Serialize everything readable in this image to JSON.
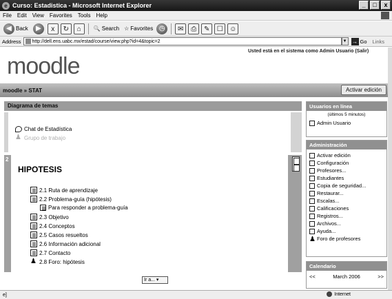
{
  "window": {
    "title": "Curso: Estadistica - Microsoft Internet Explorer",
    "buttons": [
      "_",
      "□",
      "x"
    ]
  },
  "menu": [
    "File",
    "Edit",
    "View",
    "Favorites",
    "Tools",
    "Help"
  ],
  "toolbar": {
    "back": "Back",
    "search": "Search",
    "favorites": "Favorites"
  },
  "address": {
    "label": "Address",
    "url": "http://dell.ens.uabc.mx/estad/course/view.php?id=4&topic=2",
    "go": "Go",
    "links": "Links"
  },
  "page": {
    "login_info": "Usted está en el sistema como Admin Usuario (Salir)",
    "logo": "moodle",
    "breadcrumb": "moodle » STAT",
    "edit_button": "Activar edición",
    "topics_header": "Diagrama de temas",
    "section0": {
      "items": [
        "Chat de Estadística",
        "Grupo de trabajo"
      ]
    },
    "section1": {
      "number": "2",
      "title": "HIPOTESIS",
      "items": [
        {
          "label": "2.1 Ruta de aprendizaje",
          "icon": "doc-icon"
        },
        {
          "label": "2.2 Problema-guía (hipótesis)",
          "icon": "doc-icon"
        },
        {
          "label": "Para responder a problema-guía",
          "icon": "doc-icon"
        },
        {
          "label": "2.3 Objetivo",
          "icon": "doc-icon"
        },
        {
          "label": "2.4 Conceptos",
          "icon": "doc-icon"
        },
        {
          "label": "2.5 Casos resueltos",
          "icon": "doc-icon"
        },
        {
          "label": "2.6 Información adicional",
          "icon": "doc-icon"
        },
        {
          "label": "2.7 Contacto",
          "icon": "doc-icon"
        },
        {
          "label": "2.8 Foro: hipótesis",
          "icon": "forum-icon"
        }
      ]
    },
    "jump": "Ir a...",
    "online_users": {
      "title": "Usuarios en línea",
      "note": "(últimos 5 minutos)",
      "user": "Admin Usuario"
    },
    "admin": {
      "title": "Administración",
      "items": [
        "Activar edición",
        "Configuración",
        "Profesores...",
        "Estudiantes",
        "Copia de seguridad...",
        "Restaurar...",
        "Escalas...",
        "Calificaciones",
        "Registros...",
        "Archivos...",
        "Ayuda...",
        "Foro de profesores"
      ]
    },
    "calendar": {
      "title": "Calendario",
      "prev": "<<",
      "month": "March 2006",
      "next": ">>"
    }
  },
  "status": {
    "left": "",
    "zone": "Internet"
  }
}
